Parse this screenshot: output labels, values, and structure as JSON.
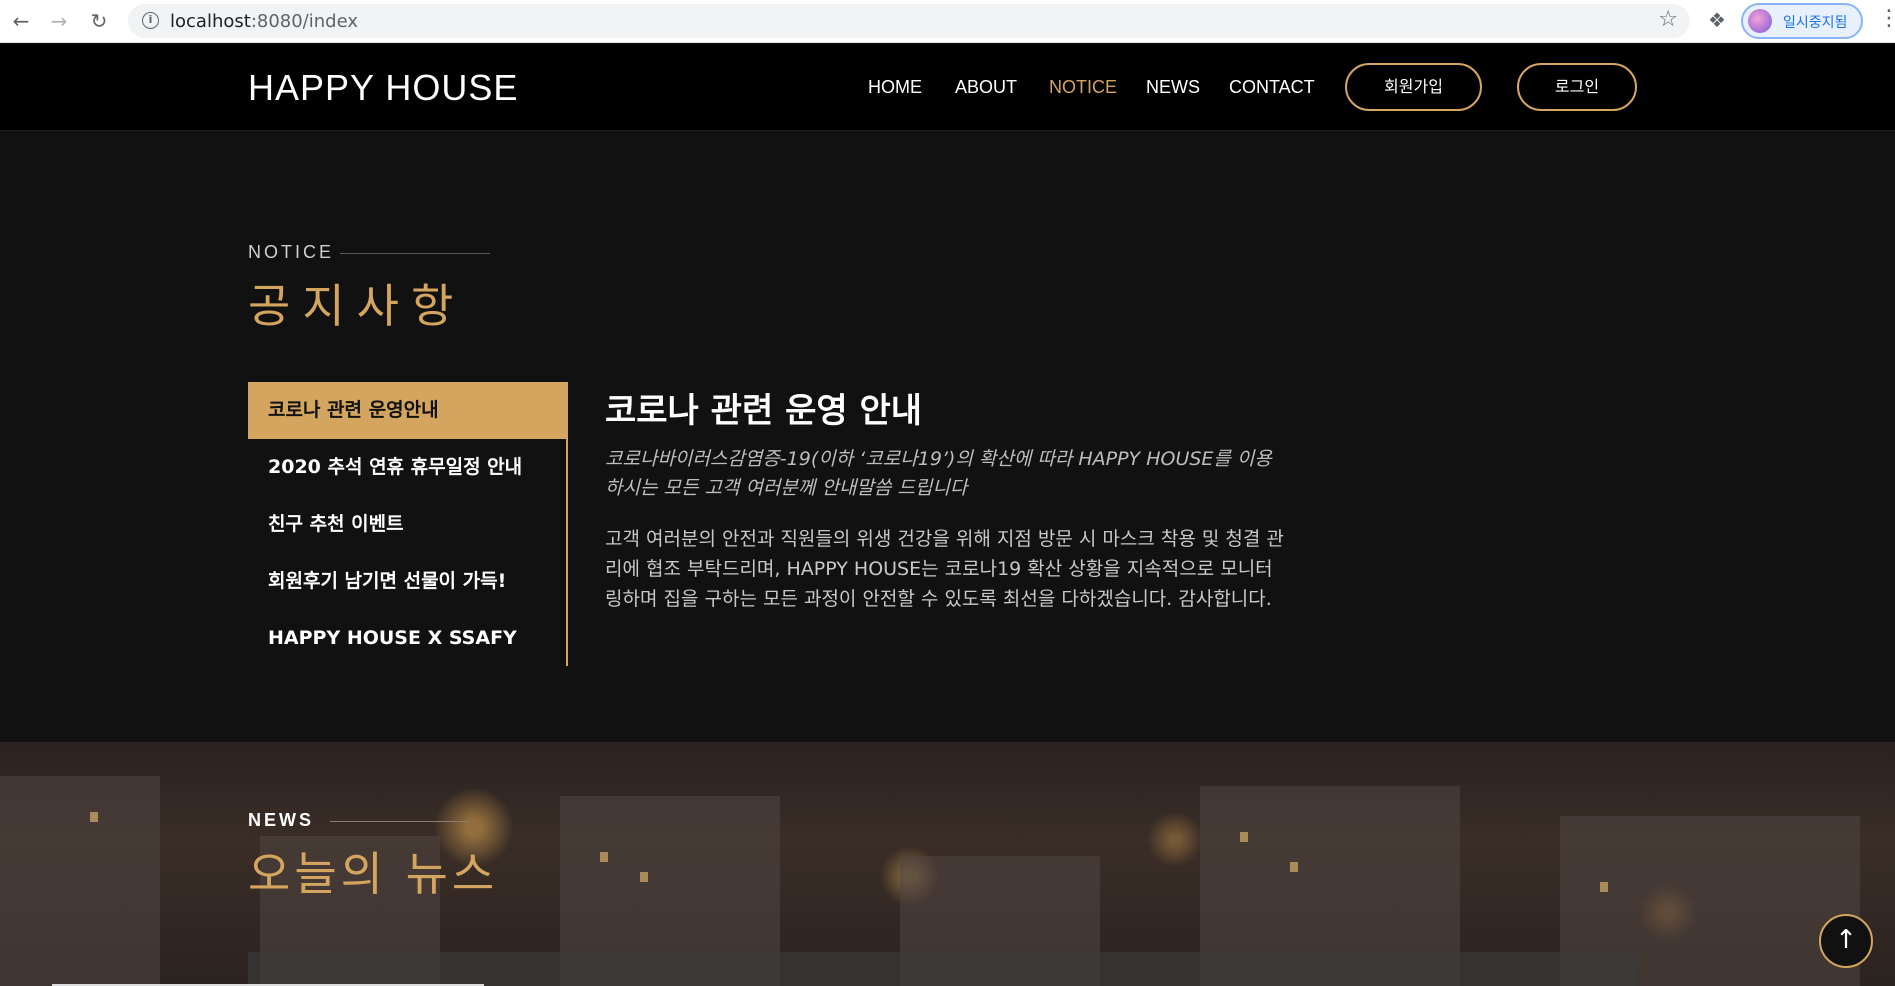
{
  "browser": {
    "url_host": "localhost",
    "url_rest": ":8080/index",
    "profile_label": "일시중지됨"
  },
  "header": {
    "logo": "HAPPY HOUSE",
    "nav": [
      "HOME",
      "ABOUT",
      "NOTICE",
      "NEWS",
      "CONTACT"
    ],
    "active_nav": "NOTICE",
    "signup_label": "회원가입",
    "login_label": "로그인",
    "accent": "#d4a55f"
  },
  "notice": {
    "eyebrow": "NOTICE",
    "title": "공지사항",
    "items": [
      "코로나 관련 운영안내",
      "2020 추석 연휴 휴무일정 안내",
      "친구 추천 이벤트",
      "회원후기 남기면 선물이 가득!",
      "HAPPY HOUSE X SSAFY"
    ],
    "active_index": 0,
    "article": {
      "title": "코로나 관련 운영 안내",
      "lead": "코로나바이러스감염증-19(이하 ‘코로나19’)의 확산에 따라 HAPPY HOUSE를 이용하시는 모든 고객 여러분께 안내말씀 드립니다",
      "body": "고객 여러분의 안전과 직원들의 위생 건강을 위해 지점 방문 시 마스크 착용 및 청결 관리에 협조 부탁드리며, HAPPY HOUSE는 코로나19 확산 상황을 지속적으로 모니터링하며 집을 구하는 모든 과정이 안전할 수 있도록 최선을 다하겠습니다. 감사합니다."
    }
  },
  "news": {
    "eyebrow": "NEWS",
    "title": "오늘의 뉴스"
  },
  "icons": {
    "back": "arrow-left-icon",
    "forward": "arrow-right-icon",
    "reload": "reload-icon",
    "site_info": "info-icon",
    "bookmark": "star-icon",
    "extensions": "puzzle-icon",
    "menu": "kebab-icon",
    "scroll_top": "arrow-up-icon"
  }
}
